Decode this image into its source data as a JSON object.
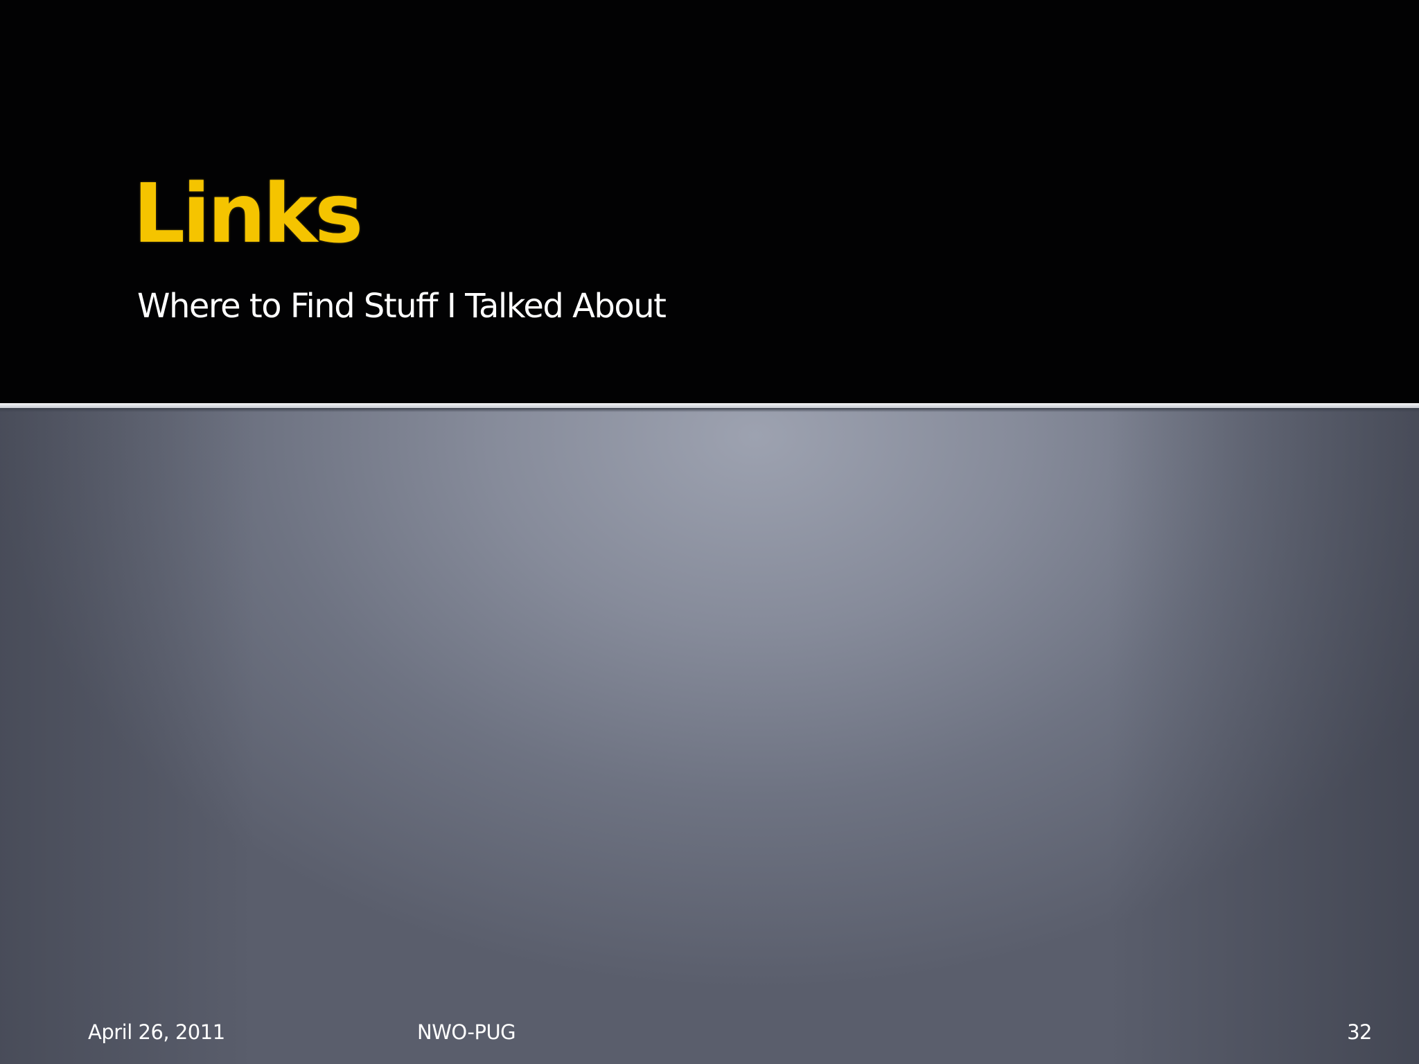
{
  "slide": {
    "title": "Links",
    "subtitle": "Where to Find Stuff I Talked About"
  },
  "footer": {
    "date": "April 26, 2011",
    "center": "NWO-PUG",
    "page_number": "32"
  },
  "colors": {
    "title": "#f5c400",
    "header_background": "#020203",
    "body_background": "#7a7f8e",
    "text": "#ffffff"
  }
}
